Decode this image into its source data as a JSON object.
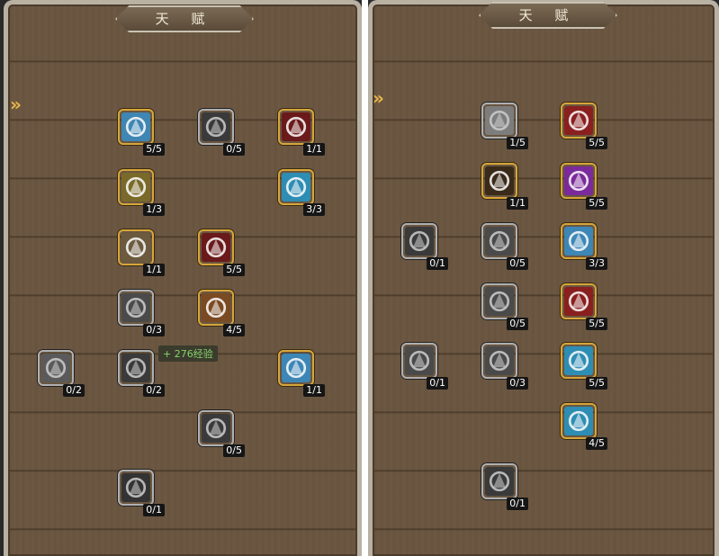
{
  "panel_left": {
    "title": "天 赋",
    "hint": "+ 276经验",
    "nodes": [
      {
        "icon": "tentacle-icon",
        "level": "5/5",
        "active": true,
        "color": "#3f86b3"
      },
      {
        "icon": "dark-wolf-icon",
        "level": "0/5",
        "active": false,
        "color": "#3a3a3a"
      },
      {
        "icon": "fanged-maw-icon",
        "level": "1/1",
        "active": true,
        "color": "#6a1a1a"
      },
      {
        "icon": "golden-armor-icon",
        "level": "1/3",
        "active": true,
        "color": "#7a6a2a"
      },
      {
        "icon": "whistle-icon",
        "level": "3/3",
        "active": true,
        "color": "#2e8db3"
      },
      {
        "icon": "boar-icon",
        "level": "1/1",
        "active": true,
        "color": "#6b5a3e"
      },
      {
        "icon": "fanged-maw-icon",
        "level": "5/5",
        "active": true,
        "color": "#6a1a1a"
      },
      {
        "icon": "claw-icon",
        "level": "0/3",
        "active": false,
        "color": "#4a4a4a"
      },
      {
        "icon": "lion-icon",
        "level": "4/5",
        "active": true,
        "color": "#7a4a22"
      },
      {
        "icon": "paw-icon",
        "level": "0/2",
        "active": false,
        "color": "#5a5a5a"
      },
      {
        "icon": "cat-icon",
        "level": "0/2",
        "active": false,
        "color": "#3a3a3a"
      },
      {
        "icon": "eagle-icon",
        "level": "1/1",
        "active": true,
        "color": "#3d86b5"
      },
      {
        "icon": "teeth-icon",
        "level": "0/5",
        "active": false,
        "color": "#3a3a3a"
      },
      {
        "icon": "bite-icon",
        "level": "0/1",
        "active": false,
        "color": "#333333"
      }
    ]
  },
  "panel_right": {
    "title": "天 赋",
    "nodes": [
      {
        "icon": "whirlwind-icon",
        "level": "1/5",
        "active": false,
        "color": "#2f8fb6"
      },
      {
        "icon": "archer-icon",
        "level": "5/5",
        "active": true,
        "color": "#8a1f1f"
      },
      {
        "icon": "target-icon",
        "level": "1/1",
        "active": true,
        "color": "#3a2a1a"
      },
      {
        "icon": "magic-archer-icon",
        "level": "5/5",
        "active": true,
        "color": "#7a2a9a"
      },
      {
        "icon": "arrowhead-icon",
        "level": "0/1",
        "active": false,
        "color": "#3a3a3a"
      },
      {
        "icon": "arrow-strike-icon",
        "level": "0/5",
        "active": false,
        "color": "#4a4a4a"
      },
      {
        "icon": "eagle-icon",
        "level": "3/3",
        "active": true,
        "color": "#3d86b5"
      },
      {
        "icon": "multi-arrow-icon",
        "level": "0/5",
        "active": false,
        "color": "#4a4a4a"
      },
      {
        "icon": "archer-icon",
        "level": "5/5",
        "active": true,
        "color": "#8a1f1f"
      },
      {
        "icon": "piercing-arrow-icon",
        "level": "0/1",
        "active": false,
        "color": "#4a4a4a"
      },
      {
        "icon": "spread-arrow-icon",
        "level": "0/3",
        "active": false,
        "color": "#4a4a4a"
      },
      {
        "icon": "ice-arrow-icon",
        "level": "5/5",
        "active": true,
        "color": "#2e8db3"
      },
      {
        "icon": "spear-icon",
        "level": "4/5",
        "active": true,
        "color": "#2e8db3"
      },
      {
        "icon": "arrowhead-icon",
        "level": "0/1",
        "active": false,
        "color": "#3a3a3a"
      }
    ]
  }
}
